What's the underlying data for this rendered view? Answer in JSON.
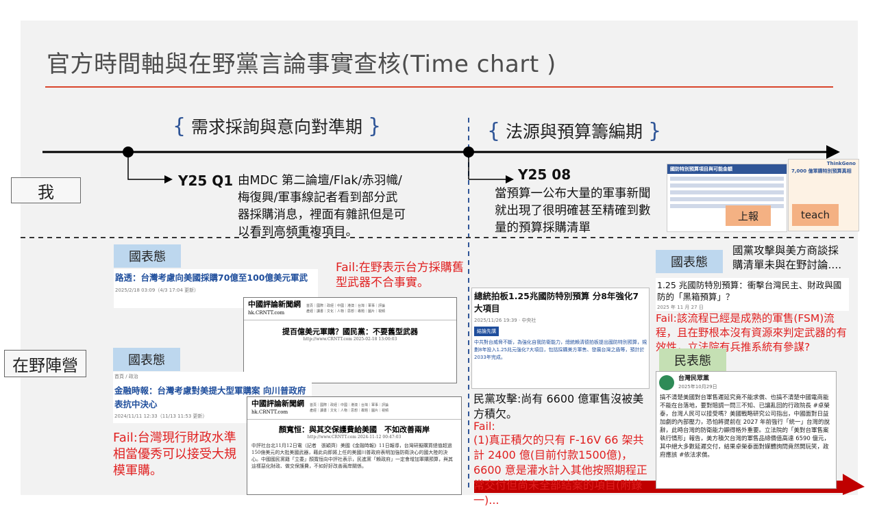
{
  "title": "官方時間軸與在野黨言論事實查核(Time chart )",
  "phases": [
    {
      "label": "需求採詢與意向對準期"
    },
    {
      "label": "法源與預算籌編期"
    }
  ],
  "rows": {
    "me": "我",
    "opposition": "在野陣營"
  },
  "milestones": [
    {
      "quarter": "Y25 Q1",
      "desc": "由MDC 第二論壇/Flak/赤羽幟/梅復興/軍事線記者看到部分武器採購消息，裡面有雜訊但是可以看到高頻重複項目。"
    },
    {
      "quarter": "Y25 08",
      "desc": "當預算一公布大量的軍事新聞就出現了很明確甚至精確到數量的預算採購清單"
    }
  ],
  "thumbs": {
    "report_title": "國防特別預算項目與可能金額",
    "report_btn": "上報",
    "teach_title": "7,000 億軍購特別預算真相",
    "teach_brand": "ThinkGeno",
    "teach_btn": "teach"
  },
  "left": {
    "tag1": "國表態",
    "card1_title": "路透：台灣考慮向美國採購70億至100億美元軍武",
    "card1_meta": "2025/2/18 03:09（4/3 17:04 更新）",
    "fail1": "Fail:在野表示台方採購舊型武器不合事實。",
    "news1_logo": "中國評論新聞網",
    "news1_logo_sub": "hk.CRNTT.com",
    "news1_head": "提百億美元軍購？國民黨：不要舊型武器",
    "news1_sub": "http://www.CRNTT.com   2025-02-18 13:00:03",
    "tag2": "國表態",
    "card2_crumb": "首頁 / 政治",
    "card2_title": "金融時報：台灣考慮對美提大型軍購案 向川普政府表抗中決心",
    "card2_meta": "2024/11/11 12:33（11/13 11:53 更新）",
    "fail2": "Fail:台灣現行財政水準相當優秀可以接受大規模軍購。",
    "news2_logo": "中國評論新聞網",
    "news2_logo_sub": "hk.CRNTT.com",
    "news2_head": "顏寬恒：與其交保護費給美國　不如改善兩岸",
    "news2_sub": "http://www.CRNTT.com   2024-11-12 00:47:03",
    "news2_body": "中評社台北11月12日電（記者　張穎齊）美國《金融時報》11日報導，台灣研擬購買總值超過150億美元的大批美國武器，藉此向即將上任的美國川普政府表明加強防衛決心的國大陸的決心。中國國民黨籍「立委」顏寬恒向中評社表示，民進黨「賴政府」一定會增加軍購預算，與其這樣惡化財政、做交保護費，不如好好改善兩岸關係。"
  },
  "center": {
    "headline": "總統拍板1.25兆國防特別預算 分8年強化7大項目",
    "meta": "2025/11/26 19:39 · 中央社",
    "conclusion": "結論先講",
    "body": "中共對台威脅不斷，為強化自我防衛能力，總統賴清德拍板提出國防特別預算，規劃8年投入1.25兆元強化7大項目，包括採購美方軍售、發展台灣之盾等，預計於2033年完成。",
    "attack": "民黨攻擊:尚有 6600 億軍售沒被美方積欠。",
    "fail_label": "Fail:",
    "fail_text": "(1)真正積欠的只有 F-16V 66 架共計 2400 億(目前付款1500億)，6600 意是灌水計入其他按照期程正常交付但尚未全部結案的項目(附錄一)..."
  },
  "right": {
    "note": "國黨攻擊與美方商談採購清單未與在野討論....",
    "tag": "國表態",
    "card_title": "1.25 兆國防特別預算：衝擊台灣民主、財政與國防的「黑箱預算」？",
    "card_meta": "2025 年 11 月 27 日",
    "fail": "Fail:該流程已經是成熟的軍售(FSM)流程，且在野根本沒有資源來判定武器的有效性，立法院有兵推系統有參謀?",
    "tag2": "民表態",
    "fb_name": "台灣民眾黨",
    "fb_date": "2025年10月29日",
    "fb_text": "搞不清楚美國對台軍售遲延究竟不能求償、也搞不清楚中國電商能不能在台落地，要對賠調一問三不知、已讓亂回的行政院長 #卓榮泰，台灣人民可以接受嗎？美國戰略研究公司指出，中國面對日益加劇的內部壓力，恐怕將提前在 2027 年前強行「統一」台灣的說辭，此時台灣的防衛能力顯得格外重要。立法院的「美對台軍售案執行情形」報告，美方積欠台灣的軍售品總價值高達 6590 億元，其中絕大多數延遲交付，結果卓榮泰面對媒體詢問竟然開玩笑，政府應該 #依法求償。"
  }
}
